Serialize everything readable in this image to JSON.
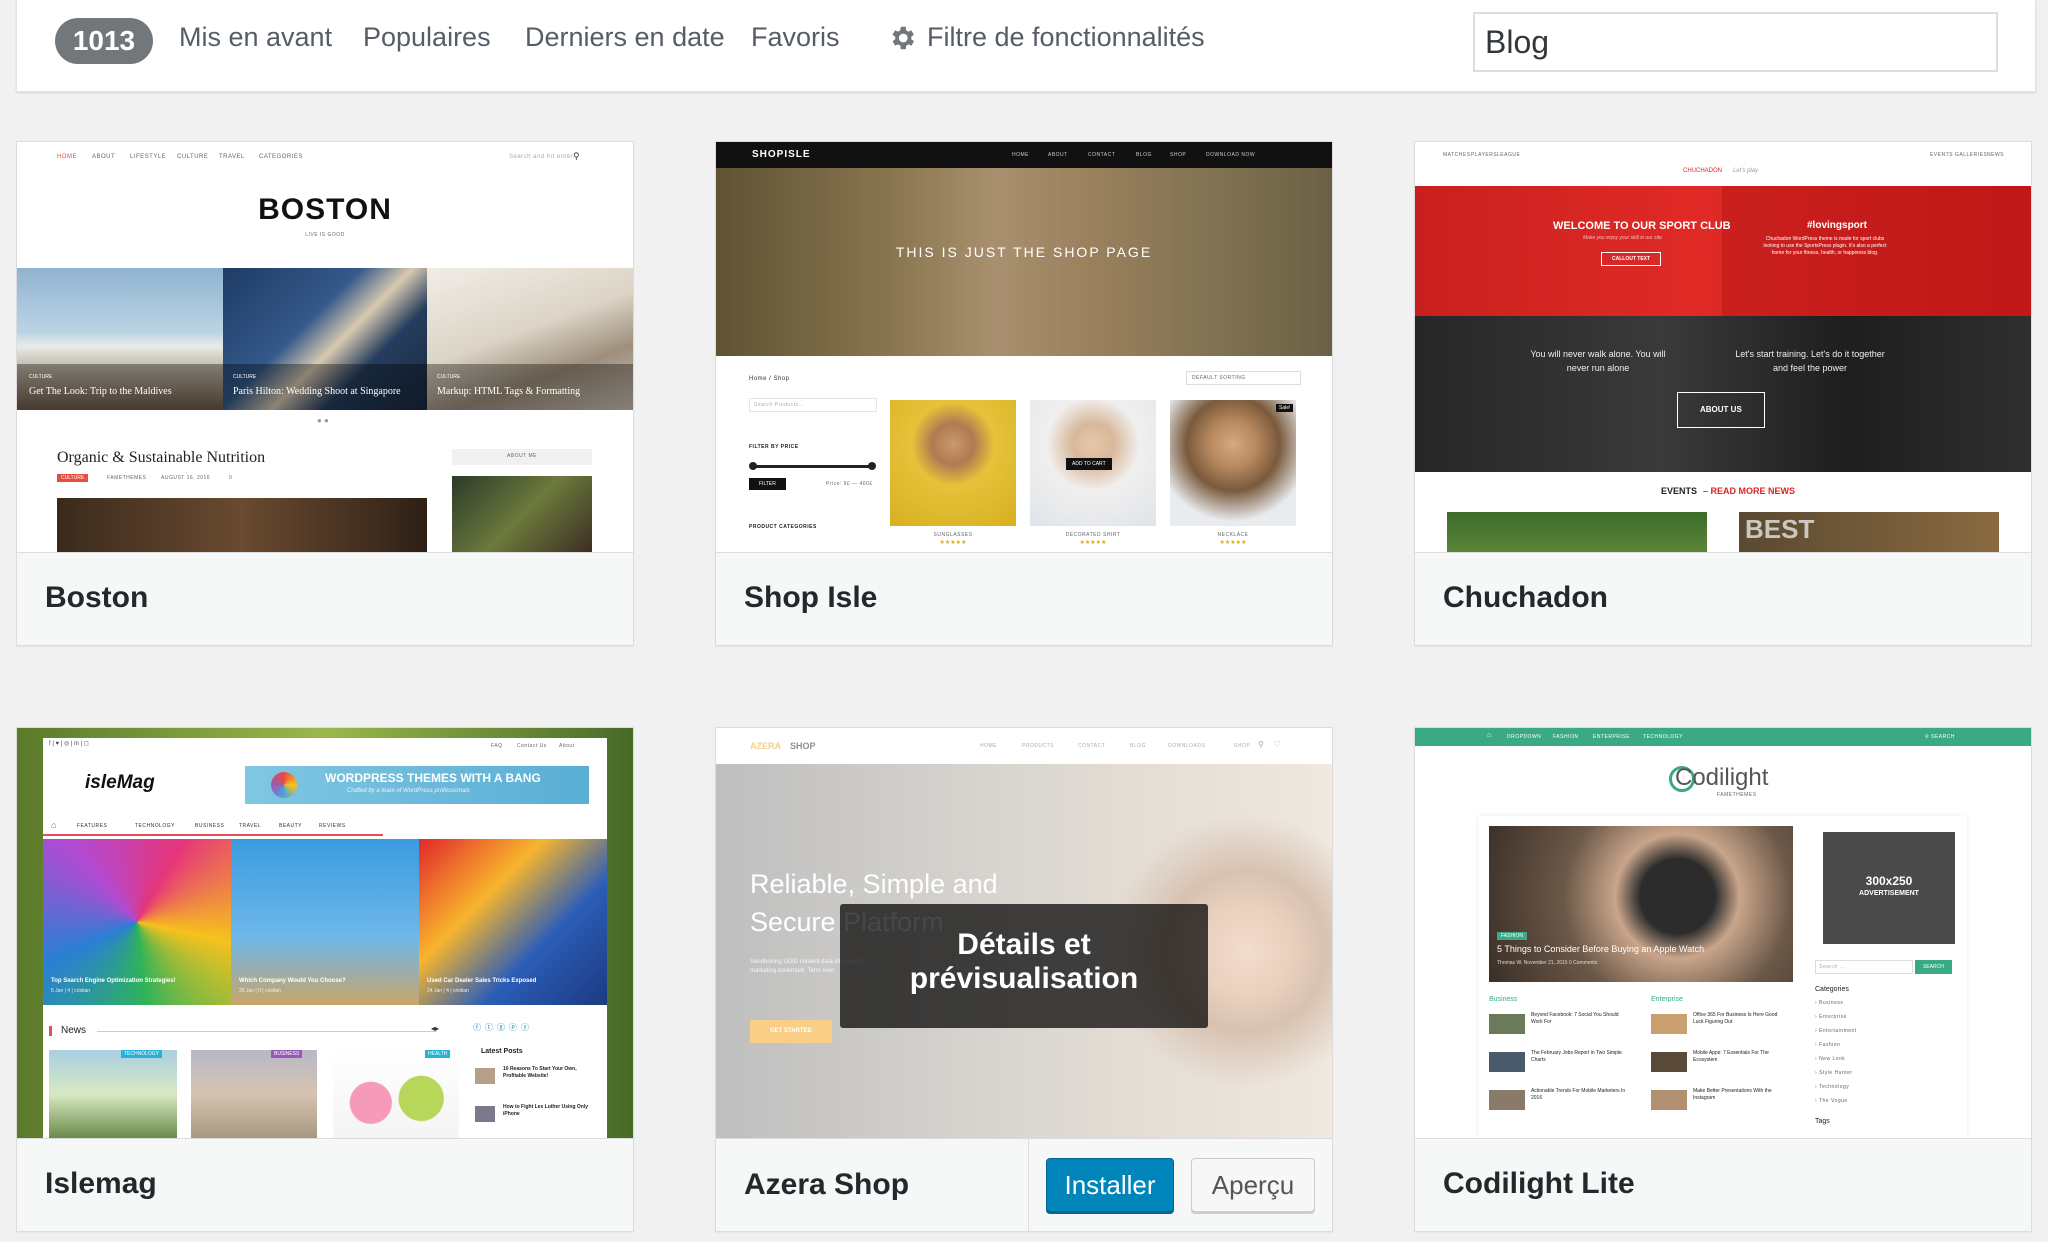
{
  "filter": {
    "count": "1013",
    "links": [
      "Mis en avant",
      "Populaires",
      "Derniers en date",
      "Favoris"
    ],
    "feature_filter": "Filtre de fonctionnalités",
    "search_value": "Blog"
  },
  "themes": [
    {
      "name": "Boston",
      "preview": {
        "nav": [
          "HOME",
          "ABOUT",
          "LIFESTYLE",
          "CULTURE",
          "TRAVEL",
          "CATEGORIES"
        ],
        "search": "Search and hit enter...",
        "logo": "BOSTON",
        "tagline": "LIVE IS GOOD",
        "slides": [
          {
            "tag": "CULTURE",
            "title": "Get The Look: Trip to the Maldives"
          },
          {
            "tag": "CULTURE",
            "title": "Paris Hilton: Wedding Shoot at Singapore"
          },
          {
            "tag": "CULTURE",
            "title": "Markup: HTML Tags & Formatting"
          }
        ],
        "post_title": "Organic & Sustainable Nutrition",
        "post_tag": "CULTURE",
        "post_author": "FAMETHEMES",
        "post_date": "AUGUST 16, 2016",
        "post_comments": "0",
        "about": "ABOUT ME"
      }
    },
    {
      "name": "Shop Isle",
      "preview": {
        "logo": "SHOPISLE",
        "nav": [
          "HOME",
          "ABOUT",
          "CONTACT",
          "BLOG",
          "SHOP",
          "DOWNLOAD NOW"
        ],
        "hero": "THIS IS JUST THE SHOP PAGE",
        "breadcrumb": "Home / Shop",
        "sorting": "DEFAULT SORTING",
        "search": "Search Products...",
        "filter_title": "FILTER BY PRICE",
        "filter_btn": "FILTER",
        "price": "Price: 9£ — 400£",
        "categories": "PRODUCT CATEGORIES",
        "add_to_cart": "ADD TO CART",
        "sale": "Sale!",
        "products": [
          "SUNGLASSES",
          "DECORATED SHIRT",
          "NECKLACE"
        ],
        "stars": "★★★★★"
      }
    },
    {
      "name": "Chuchadon",
      "preview": {
        "nav_left": [
          "MATCHES",
          "PLAYERS",
          "LEAGUE"
        ],
        "nav_right": [
          "EVENTS",
          "GALLERIES",
          "NEWS"
        ],
        "logo": "CHUCHADON",
        "tagline": "Let's play",
        "welcome": "WELCOME TO OUR SPORT CLUB",
        "welcome_sub": "Make you enjoy your skill in our site",
        "callout": "CALLOUT TEXT",
        "hashtag": "#lovingsport",
        "hashtag_text": "Chuchadon WordPress theme is made for sport clubs looking to use the SportsPress plugin. It's also a perfect home for your fitness, health, or happiness blog.",
        "quote1": "You will never walk alone. You will never run alone",
        "quote2": "Let's start training. Let's do it together and feel the power",
        "about": "ABOUT US",
        "events": "EVENTS",
        "read_more": "READ MORE NEWS",
        "best": "BEST"
      }
    },
    {
      "name": "Islemag",
      "preview": {
        "top_links": [
          "FAQ",
          "Contact Us",
          "About"
        ],
        "logo": "isleMag",
        "banner": "WORDPRESS THEMES WITH A BANG",
        "banner_sub": "Crafted by a team of WordPress professionals",
        "nav": [
          "FEATURES",
          "TECHNOLOGY",
          "BUSINESS",
          "TRAVEL",
          "BEAUTY",
          "REVIEWS"
        ],
        "slides": [
          {
            "title": "Top Search Engine Optimization Strategies!",
            "meta": "5 Jan  |  4  |  cristian"
          },
          {
            "title": "Which Company Would You Choose?",
            "meta": "25 Jan  |  0  |  cristian"
          },
          {
            "title": "Used Car Dealer Sales Tricks Exposed",
            "meta": "24 Jan  |  4  |  cristian"
          }
        ],
        "news": "News",
        "tags": [
          "TECHNOLOGY",
          "BUSINESS",
          "HEALTH"
        ],
        "latest": "Latest Posts",
        "latest_posts": [
          "10 Reasons To Start Your Own, Profitable Website!",
          "How to Fight Lex Luther Using Only iPhone"
        ]
      }
    },
    {
      "name": "Azera Shop",
      "preview": {
        "logo_a": "AZERA",
        "logo_b": "SHOP",
        "nav": [
          "HOME",
          "PRODUCTS",
          "CONTACT",
          "BLOG",
          "DOWNLOADS",
          "SHOP"
        ],
        "hero_line1": "Reliable, Simple and",
        "hero_line2": "Secure Platform",
        "hero_text": "Sandboxing UDID content data infographic, marketing bookmark. Term ever",
        "cta": "GET STARTED"
      },
      "details": "Détails et prévisualisation",
      "install": "Installer",
      "preview_btn": "Aperçu"
    },
    {
      "name": "Codilight Lite",
      "preview": {
        "nav": [
          "DROPDOWN",
          "FASHION",
          "ENTERPRISE",
          "TECHNOLOGY"
        ],
        "search": "SEARCH",
        "logo": "Codilight",
        "logo_sub": "FAMETHEMES",
        "feature_tag": "FASHION",
        "feature_title": "5 Things to Consider Before Buying an Apple Watch",
        "feature_meta": "Thomas W.   November 21, 2015   0 Comments",
        "ad": "300x250",
        "ad_sub": "ADVERTISEMENT",
        "search_ph": "Search ...",
        "search_btn": "SEARCH",
        "col1": "Business",
        "col2": "Enterprise",
        "col1_posts": [
          "Beyond Facebook: 7 Social You Should Work For",
          "The February Jobs Report in Two Simple Charts",
          "Actionable Trends For Mobile Marketers In 2016"
        ],
        "col2_posts": [
          "Office 365 For Business Is Here Good Luck Figuring Out",
          "Mobile Apps: 7 Essentials For The Ecosystem",
          "Make Better Presentations With the Instagram"
        ],
        "categories_title": "Categories",
        "categories": [
          "Business",
          "Enterprise",
          "Entertainment",
          "Fashion",
          "New Look",
          "Style Hunter",
          "Technology",
          "The Vogue"
        ],
        "tags": "Tags"
      }
    }
  ]
}
